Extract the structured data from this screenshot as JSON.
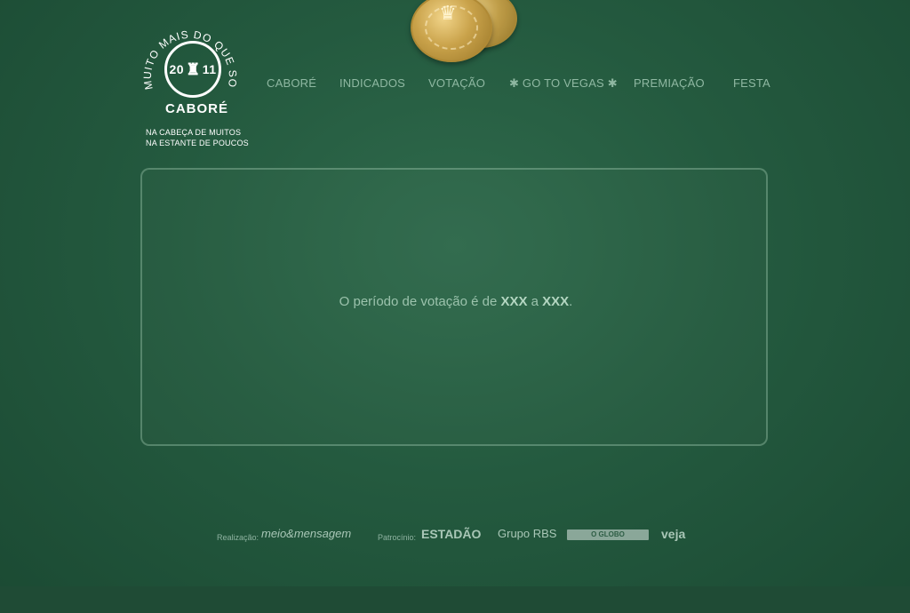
{
  "logo": {
    "arc_text": "MUITO MAIS DO QUE SORTE",
    "year": "2011",
    "year_left": "20",
    "year_right": "11",
    "name": "CABORÉ",
    "tagline_1": "NA CABEÇA DE MUITOS",
    "tagline_2": "NA ESTANTE DE POUCOS"
  },
  "nav": {
    "items": [
      "CABORÉ",
      "INDICADOS",
      "VOTAÇÃO",
      "✱ GO TO VEGAS ✱",
      "PREMIAÇÃO",
      "FESTA"
    ]
  },
  "panel": {
    "message_prefix": "O período de votação é de ",
    "start": "XXX",
    "middle": " a ",
    "end": "XXX",
    "suffix": "."
  },
  "footer": {
    "realizacao_label": "Realização:",
    "realizacao_brand": "meio&mensagem",
    "patrocinio_label": "Patrocínio:",
    "sponsors": [
      "ESTADÃO",
      "Grupo RBS",
      "O GLOBO",
      "veja"
    ]
  },
  "colors": {
    "background": "#245a3f",
    "nav_text": "#8fb8a2",
    "chip_gold": "#c9a24a"
  }
}
